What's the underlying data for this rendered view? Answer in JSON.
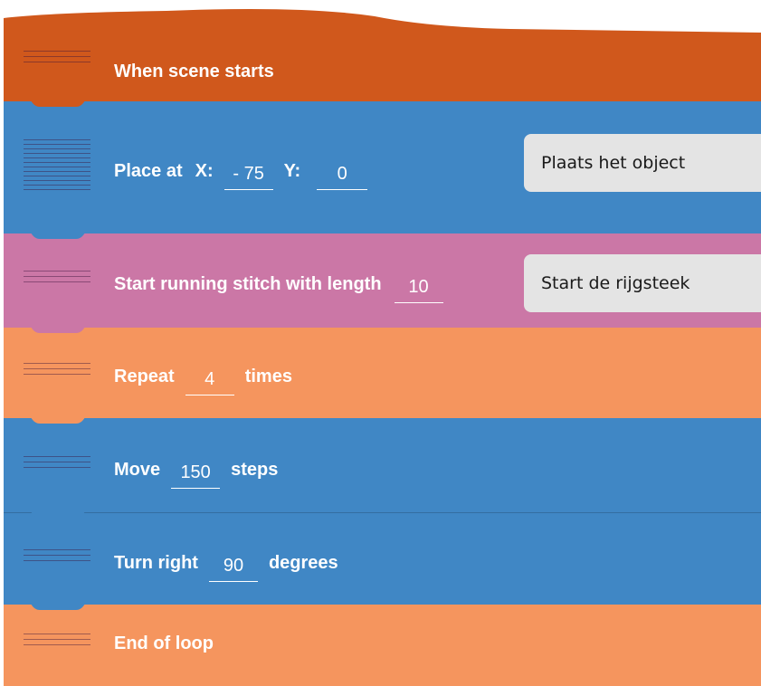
{
  "colors": {
    "event": "#d0581c",
    "motion": "#4087c5",
    "stitch": "#cb77a6",
    "control": "#f5955e",
    "comment_bg": "#e4e4e4"
  },
  "blocks": [
    {
      "type": "event",
      "color": "#d0581c",
      "label": "When scene starts"
    },
    {
      "type": "place",
      "color": "#4087c5",
      "label": "Place at",
      "x_label": "X:",
      "x_value": "- 75",
      "y_label": "Y:",
      "y_value": "0",
      "comment": "Plaats het object"
    },
    {
      "type": "stitch",
      "color": "#cb77a6",
      "label": "Start running stitch with length",
      "value": "10",
      "comment": "Start de rijgsteek"
    },
    {
      "type": "repeat",
      "color": "#f5955e",
      "label": "Repeat",
      "value": "4",
      "suffix": "times"
    },
    {
      "type": "move",
      "color": "#4087c5",
      "label": "Move",
      "value": "150",
      "suffix": "steps"
    },
    {
      "type": "turn",
      "color": "#4087c5",
      "label": "Turn right",
      "value": "90",
      "suffix": "degrees"
    },
    {
      "type": "end",
      "color": "#f5955e",
      "label": "End of loop"
    }
  ]
}
